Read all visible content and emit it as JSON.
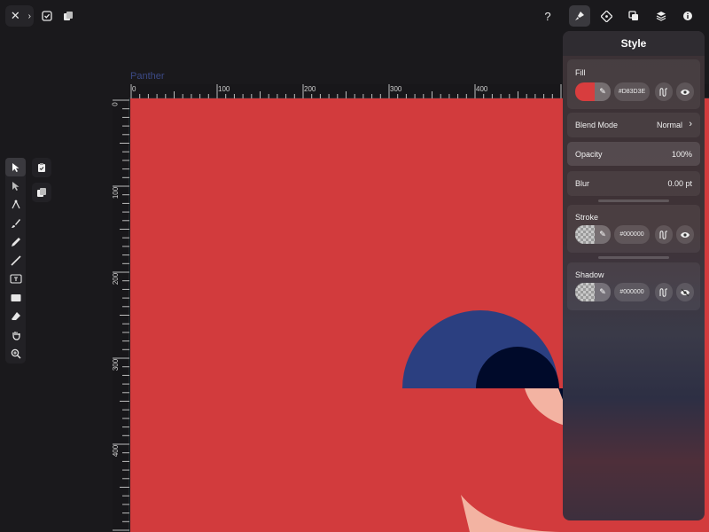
{
  "toolbar": {
    "close_icon": "close-icon",
    "chevron_icon": "chevron-right-icon",
    "help_label": "?"
  },
  "document": {
    "title": "Panther"
  },
  "rulers": {
    "horizontal": [
      "0",
      "100",
      "200",
      "300",
      "400"
    ],
    "vertical": [
      "0",
      "100",
      "200",
      "300",
      "400"
    ]
  },
  "panel": {
    "title": "Style",
    "fill": {
      "label": "Fill",
      "hex": "#D83D3E",
      "color": "#d83d3e"
    },
    "blend_mode": {
      "label": "Blend Mode",
      "value": "Normal"
    },
    "opacity": {
      "label": "Opacity",
      "value": "100%"
    },
    "blur": {
      "label": "Blur",
      "value": "0.00 pt"
    },
    "stroke": {
      "label": "Stroke",
      "hex": "#000000"
    },
    "shadow": {
      "label": "Shadow",
      "hex": "#000000"
    }
  },
  "colors": {
    "canvas": "#d23b3d",
    "navy": "#2b3f80",
    "dark_navy": "#000a2a",
    "peach": "#f3b3a2"
  }
}
